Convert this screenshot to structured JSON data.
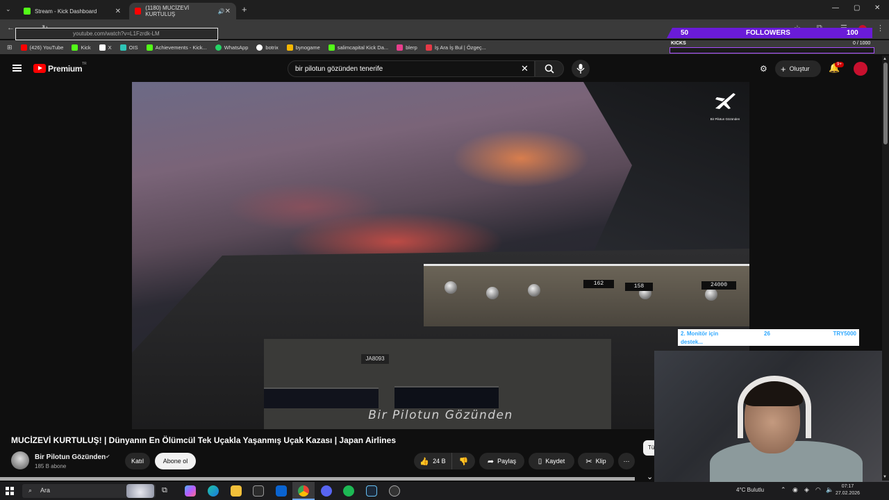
{
  "browser": {
    "tabs": [
      {
        "label": "Stream - Kick Dashboard",
        "favicon_color": "#53fc18"
      },
      {
        "label": "(1180) MUCİZEVİ KURTULUŞ",
        "favicon_color": "#ff0000"
      }
    ],
    "address": "youtube.com/watch?v=L1Fzrdk-LM",
    "bookmarks": [
      {
        "label": "(426) YouTube",
        "color": "#ff0000"
      },
      {
        "label": "Kick",
        "color": "#53fc18"
      },
      {
        "label": "X",
        "color": "#ffffff"
      },
      {
        "label": "OIS",
        "color": "#2ec4b6"
      },
      {
        "label": "Achievements - Kick...",
        "color": "#53fc18"
      },
      {
        "label": "WhatsApp",
        "color": "#25d366"
      },
      {
        "label": "botrix",
        "color": "#ffffff"
      },
      {
        "label": "bynogame",
        "color": "#f5b700"
      },
      {
        "label": "salimcapital Kick Da...",
        "color": "#53fc18"
      },
      {
        "label": "blerp",
        "color": "#e83e8c"
      },
      {
        "label": "İş Ara İş Bul | Özgeç...",
        "color": "#e63946"
      }
    ]
  },
  "overlay": {
    "followers_count": "50",
    "followers_label": "FOLLOWERS",
    "followers_goal": "100",
    "kicks_label": "KICKS",
    "kicks_count": "0  / 1000",
    "donation_goal": "2. Monitör için",
    "donation_goal_cut": "destek...",
    "donation_count": "26",
    "donation_amount": "TRY5000"
  },
  "youtube": {
    "brand": "Premium",
    "region": "TR",
    "search_query": "bir pilotun gözünden tenerife",
    "create_label": "Oluştur",
    "notifications": "9+"
  },
  "video": {
    "caption": "Bir Pilotun Gözünden",
    "watermark_name": "Bir Pilotun Gözünden",
    "registration": "JA8093",
    "lcd_values": [
      "162",
      "158",
      "24000"
    ],
    "title": "MUCİZEVİ KURTULUŞ! | Dünyanın En Ölümcül Tek Uçakla Yaşanmış Uçak Kazası | Japan Airlines"
  },
  "channel": {
    "name": "Bir Pilotun Gözünden",
    "subscribers": "185 B abone",
    "join_label": "Katıl",
    "subscribe_label": "Abone ol"
  },
  "actions": {
    "likes": "24 B",
    "share": "Paylaş",
    "save": "Kaydet",
    "clip": "Klip",
    "side_chip": "Tü"
  },
  "taskbar": {
    "search_placeholder": "Ara",
    "weather": "4°C  Bulutlu",
    "time": "07:17",
    "date": "27.02.2026"
  }
}
